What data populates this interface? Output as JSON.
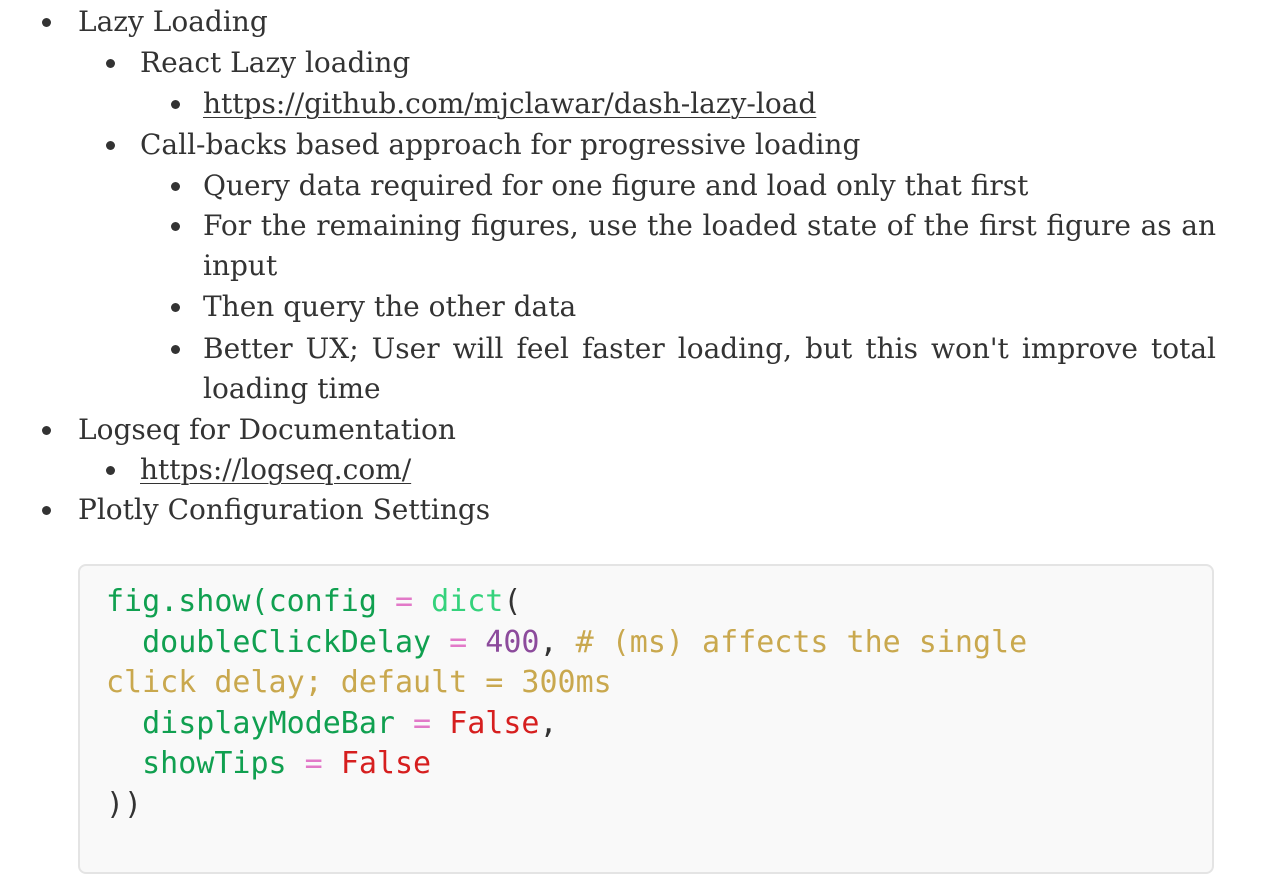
{
  "outline": {
    "lazy_loading": "Lazy Loading",
    "react_lazy": "React Lazy loading",
    "react_lazy_link": "https://github.com/mjclawar/dash-lazy-load",
    "callbacks": "Call-backs based approach for progressive loading",
    "query_first": "Query data required for one figure and load only that first",
    "remaining_line1": "For the remaining figures, use the loaded state of the first figure as an",
    "remaining_line2": "input",
    "then_query": "Then query the other data",
    "better_ux_line1": "Better UX; User will feel faster loading, but this won't improve total",
    "better_ux_line2": "loading time",
    "logseq": "Logseq for Documentation",
    "logseq_link": "https://logseq.com/",
    "plotly": "Plotly Configuration Settings"
  },
  "code": {
    "t_fig": "fig.show(",
    "t_config": "config",
    "t_eq1": " = ",
    "t_dict": "dict",
    "t_paren_open": "(",
    "t_indent1": "  ",
    "t_dcd": "doubleClickDelay",
    "t_eq2": " = ",
    "t_400": "400",
    "t_comma1": ", ",
    "t_comment1": "# (ms) affects the single",
    "t_comment2": "click delay; default = 300ms",
    "t_indent2": "  ",
    "t_dmb": "displayModeBar",
    "t_eq3": " = ",
    "t_false1": "False",
    "t_comma2": ",",
    "t_indent3": "  ",
    "t_st": "showTips",
    "t_eq4": " = ",
    "t_false2": "False",
    "t_close": "))"
  }
}
